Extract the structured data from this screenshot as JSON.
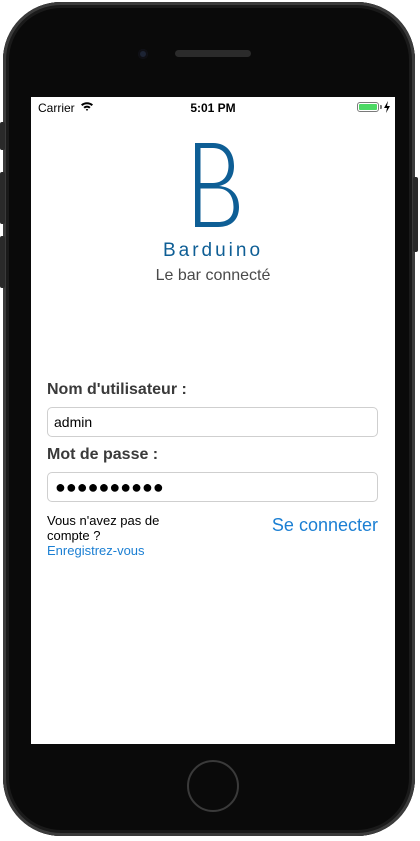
{
  "status_bar": {
    "carrier": "Carrier",
    "time": "5:01 PM",
    "battery_color": "#4cd964"
  },
  "brand": {
    "logo_letter": "B",
    "name": "Barduino",
    "tagline": "Le bar connecté",
    "color": "#0e5e95"
  },
  "form": {
    "username_label": "Nom d'utilisateur :",
    "username_value": "admin",
    "password_label": "Mot de passe :",
    "password_masked": "●●●●●●●●●●",
    "no_account_text": "Vous n'avez pas de compte ?",
    "register_link": "Enregistrez-vous",
    "connect_button": "Se connecter",
    "link_color": "#1b7fd3"
  }
}
